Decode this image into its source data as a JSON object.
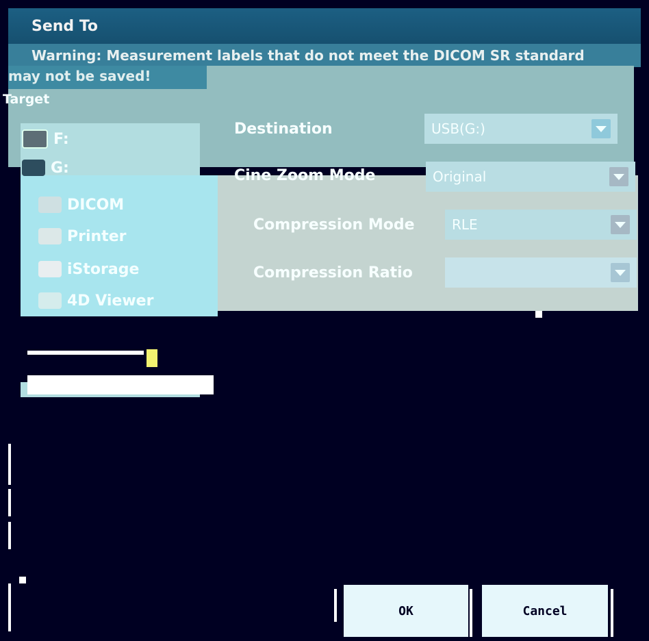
{
  "dialog": {
    "title": "Send To",
    "warning_line1": "Warning: Measurement labels that do not meet the DICOM SR standard",
    "warning_line2": "may not be saved!"
  },
  "target": {
    "label": "Target",
    "items": [
      {
        "label": "F:",
        "icon": "drive-icon"
      },
      {
        "label": "G:",
        "icon": "usb-drive-icon"
      },
      {
        "label": "DICOM",
        "icon": "dicom-icon"
      },
      {
        "label": "Printer",
        "icon": "printer-icon"
      },
      {
        "label": "iStorage",
        "icon": "storage-icon"
      },
      {
        "label": "4D Viewer",
        "icon": "viewer-icon"
      }
    ]
  },
  "settings": {
    "destination_label": "Destination",
    "destination_value": "USB(G:)",
    "cine_zoom_label": "Cine Zoom Mode",
    "cine_zoom_value": "Original",
    "compression_mode_label": "Compression Mode",
    "compression_mode_value": "RLE",
    "compression_ratio_label": "Compression Ratio",
    "compression_ratio_value": ""
  },
  "buttons": {
    "ok_label": "OK",
    "cancel_label": "Cancel"
  },
  "colors": {
    "title_bar": "#1c5f83",
    "panel": "#93bdbf",
    "list_bg": "#b2dde0",
    "background": "#000022"
  }
}
